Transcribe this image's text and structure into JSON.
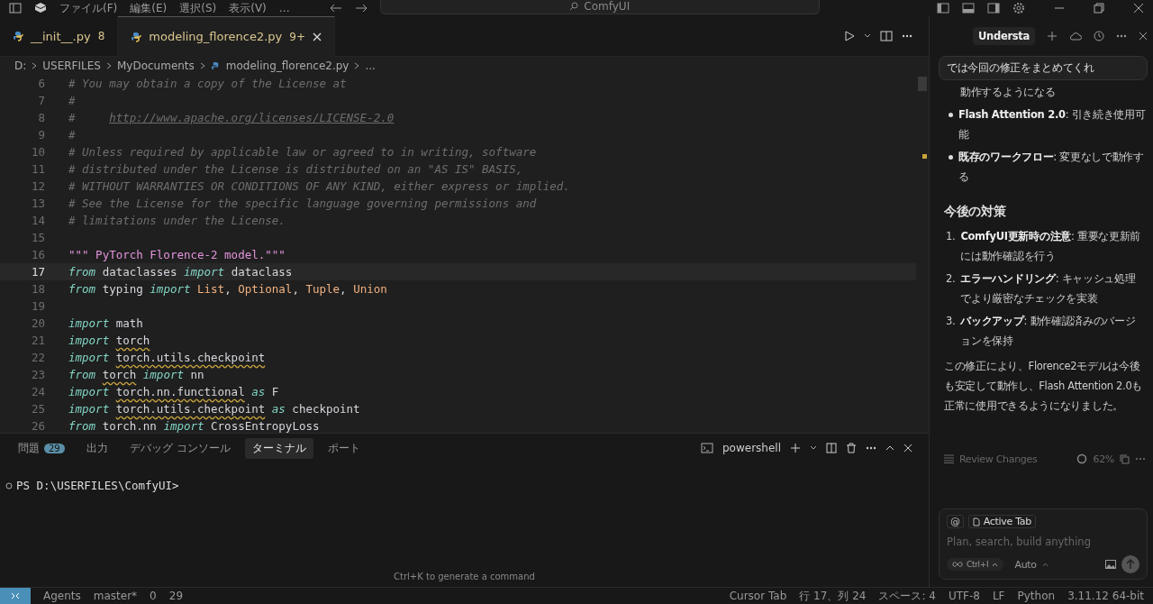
{
  "title_bar": {
    "menus": [
      "ファイル(F)",
      "編集(E)",
      "選択(S)",
      "表示(V)",
      "…"
    ],
    "search": "ComfyUI"
  },
  "tabs": [
    {
      "label": "__init__.py",
      "badge": "8",
      "selected": false
    },
    {
      "label": "modeling_florence2.py",
      "badge": "9+",
      "selected": true
    }
  ],
  "breadcrumb": [
    "D:",
    "USERFILES",
    "MyDocuments",
    "modeling_florence2.py",
    "..."
  ],
  "editor": {
    "lines": [
      {
        "number": "6",
        "current": false,
        "tokens": [
          {
            "text": "# You may obtain a copy of the License at",
            "kind": "comment"
          }
        ]
      },
      {
        "number": "7",
        "current": false,
        "tokens": [
          {
            "text": "#",
            "kind": "comment"
          }
        ]
      },
      {
        "number": "8",
        "current": false,
        "tokens": [
          {
            "text": "#     ",
            "kind": "comment"
          },
          {
            "text": "http://www.apache.org/licenses/LICENSE-2.0",
            "kind": "link"
          }
        ]
      },
      {
        "number": "9",
        "current": false,
        "tokens": [
          {
            "text": "#",
            "kind": "comment"
          }
        ]
      },
      {
        "number": "10",
        "current": false,
        "tokens": [
          {
            "text": "# Unless required by applicable law or agreed to in writing, software",
            "kind": "comment"
          }
        ]
      },
      {
        "number": "11",
        "current": false,
        "tokens": [
          {
            "text": "# distributed under the License is distributed on an \"AS IS\" BASIS,",
            "kind": "comment"
          }
        ]
      },
      {
        "number": "12",
        "current": false,
        "tokens": [
          {
            "text": "# WITHOUT WARRANTIES OR CONDITIONS OF ANY KIND, either express or implied.",
            "kind": "comment"
          }
        ]
      },
      {
        "number": "13",
        "current": false,
        "tokens": [
          {
            "text": "# See the License for the specific language governing permissions and",
            "kind": "comment"
          }
        ]
      },
      {
        "number": "14",
        "current": false,
        "tokens": [
          {
            "text": "# limitations under the License.",
            "kind": "comment"
          }
        ]
      },
      {
        "number": "15",
        "current": false
      },
      {
        "number": "16",
        "current": false,
        "tokens": [
          {
            "text": "\"\"\" PyTorch Florence-2 model.\"\"\"",
            "kind": "string"
          }
        ]
      },
      {
        "number": "17",
        "current": true,
        "tokens": [
          {
            "text": "from",
            "kind": "keyword"
          },
          {
            "text": " dataclasses ",
            "kind": "plain"
          },
          {
            "text": "import",
            "kind": "keyword"
          },
          {
            "text": " dataclass",
            "kind": "plain"
          }
        ]
      },
      {
        "number": "18",
        "current": false,
        "tokens": [
          {
            "text": "from",
            "kind": "keyword"
          },
          {
            "text": " typing ",
            "kind": "plain"
          },
          {
            "text": "import",
            "kind": "keyword"
          },
          {
            "text": " List",
            "kind": "type"
          },
          {
            "text": ", ",
            "kind": "plain"
          },
          {
            "text": "Optional",
            "kind": "type"
          },
          {
            "text": ", ",
            "kind": "plain"
          },
          {
            "text": "Tuple",
            "kind": "type"
          },
          {
            "text": ", ",
            "kind": "plain"
          },
          {
            "text": "Union",
            "kind": "type"
          }
        ]
      },
      {
        "number": "19",
        "current": false
      },
      {
        "number": "20",
        "current": false,
        "tokens": [
          {
            "text": "import",
            "kind": "keyword"
          },
          {
            "text": " math",
            "kind": "plain"
          }
        ]
      },
      {
        "number": "21",
        "current": false,
        "tokens": [
          {
            "text": "import ",
            "kind": "keyword"
          },
          {
            "text": "torch",
            "kind": "warn"
          }
        ]
      },
      {
        "number": "22",
        "current": false,
        "tokens": [
          {
            "text": "import ",
            "kind": "keyword"
          },
          {
            "text": "torch.utils.checkpoint",
            "kind": "warn"
          }
        ]
      },
      {
        "number": "23",
        "current": false,
        "tokens": [
          {
            "text": "from ",
            "kind": "keyword"
          },
          {
            "text": "torch",
            "kind": "warn"
          },
          {
            "text": " import",
            "kind": "keyword"
          },
          {
            "text": " nn",
            "kind": "plain"
          }
        ]
      },
      {
        "number": "24",
        "current": false,
        "tokens": [
          {
            "text": "import ",
            "kind": "keyword"
          },
          {
            "text": "torch.nn.functional",
            "kind": "warn"
          },
          {
            "text": " as",
            "kind": "keyword"
          },
          {
            "text": " F",
            "kind": "plain"
          }
        ]
      },
      {
        "number": "25",
        "current": false,
        "tokens": [
          {
            "text": "import ",
            "kind": "keyword"
          },
          {
            "text": "torch.utils.checkpoint",
            "kind": "warn"
          },
          {
            "text": " as",
            "kind": "keyword"
          },
          {
            "text": " checkpoint",
            "kind": "plain"
          }
        ]
      },
      {
        "number": "26",
        "current": false,
        "tokens": [
          {
            "text": "from ",
            "kind": "keyword"
          },
          {
            "text": "torch.nn",
            "kind": "warn"
          },
          {
            "text": " import",
            "kind": "keyword"
          },
          {
            "text": " CrossEntropyLoss",
            "kind": "plain"
          }
        ]
      }
    ]
  },
  "panel": {
    "tabs": [
      {
        "label": "問題",
        "badge": "29",
        "selected": false
      },
      {
        "label": "出力",
        "selected": false
      },
      {
        "label": "デバッグ コンソール",
        "selected": false
      },
      {
        "label": "ターミナル",
        "selected": true
      },
      {
        "label": "ポート",
        "selected": false
      }
    ],
    "shell": "powershell",
    "prompt": "PS D:\\USERFILES\\ComfyUI>",
    "hint": "Ctrl+K to generate a command"
  },
  "chat": {
    "tab": "Understa",
    "prompt": "では今回の修正をまとめてくれ",
    "blocks": [
      {
        "kind": "continuation",
        "text": "動作するようになる"
      },
      {
        "kind": "bullet",
        "text": "**Flash Attention 2.0**: 引き続き使用可能"
      },
      {
        "kind": "bullet",
        "text": "**既存のワークフロー**: 変更なしで動作する"
      },
      {
        "kind": "heading",
        "text": "今後の対策"
      },
      {
        "kind": "numbered",
        "number": "1.",
        "text": "**ComfyUI更新時の注意**: 重要な更新前には動作確認を行う"
      },
      {
        "kind": "numbered",
        "number": "2.",
        "text": "**エラーハンドリング**: キャッシュ処理でより厳密なチェックを実装"
      },
      {
        "kind": "numbered",
        "number": "3.",
        "text": "**バックアップ**: 動作確認済みのバージョンを保持"
      },
      {
        "kind": "paragraph",
        "text": "この修正により、Florence2モデルは今後も安定して動作し、Flash Attention 2.0も正常に使用できるようになりました。"
      }
    ],
    "review": "Review Changes",
    "progress": "62%",
    "input": {
      "mention": "@",
      "chip": "Active Tab",
      "placeholder": "Plan, search, build anything",
      "mode": "Ctrl+I",
      "model": "Auto"
    }
  },
  "status_bar": [
    "Agents",
    "master*",
    "0",
    "29",
    "Cursor Tab",
    "行 17、列 24",
    "スペース: 4",
    "UTF-8",
    "LF",
    "Python",
    "3.11.12 64-bit"
  ]
}
